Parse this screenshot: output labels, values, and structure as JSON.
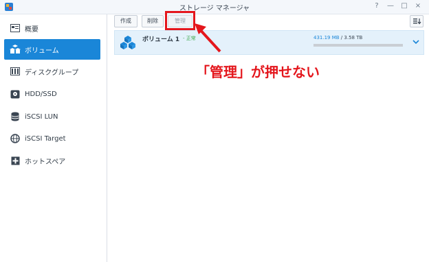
{
  "window": {
    "title": "ストレージ マネージャ",
    "help": "?",
    "minimize": "—",
    "maximize": "□",
    "close": "×"
  },
  "sidebar": {
    "items": [
      {
        "label": "概要",
        "icon": "overview-icon",
        "active": false
      },
      {
        "label": "ボリューム",
        "icon": "volume-icon",
        "active": true
      },
      {
        "label": "ディスクグループ",
        "icon": "disk-group-icon",
        "active": false
      },
      {
        "label": "HDD/SSD",
        "icon": "hdd-icon",
        "active": false
      },
      {
        "label": "iSCSI LUN",
        "icon": "iscsi-lun-icon",
        "active": false
      },
      {
        "label": "iSCSI Target",
        "icon": "iscsi-target-icon",
        "active": false
      },
      {
        "label": "ホットスペア",
        "icon": "hot-spare-icon",
        "active": false
      }
    ]
  },
  "toolbar": {
    "create": "作成",
    "delete": "削除",
    "manage": "管理",
    "manage_disabled": true
  },
  "volume": {
    "name": "ボリューム 1",
    "status": "- 正常",
    "used": "431.19 MB",
    "separator": "/",
    "total": "3.58 TB",
    "usage_fraction": 0.0
  },
  "annotation": {
    "text": "「管理」が押せない",
    "color": "#e4161c"
  },
  "colors": {
    "accent": "#1a86d8",
    "status_ok": "#3aa74a",
    "annotation": "#e4161c"
  }
}
